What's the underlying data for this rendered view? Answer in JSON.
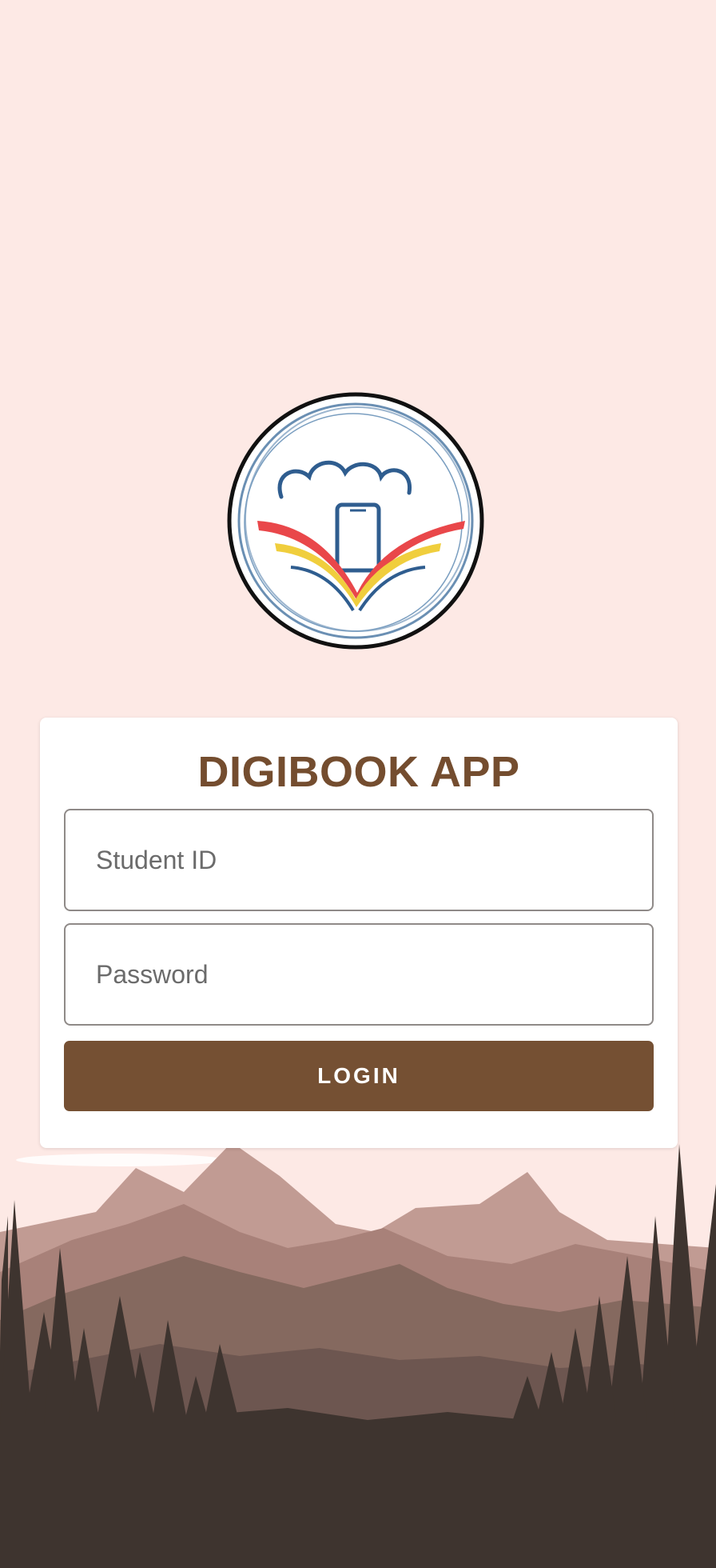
{
  "app": {
    "title": "DIGIBOOK APP"
  },
  "login_form": {
    "student_id_placeholder": "Student ID",
    "student_id_value": "",
    "password_placeholder": "Password",
    "password_value": "",
    "login_label": "LOGIN"
  },
  "icons": {
    "logo": "digibook-logo-icon",
    "background": "mountain-forest-landscape"
  },
  "colors": {
    "background": "#fde9e5",
    "title": "#744d2f",
    "button": "#755033",
    "button_text": "#ffffff",
    "field_border": "#8f8a88",
    "forest_dark": "#3e342f",
    "mountain_mid": "#7d6560",
    "mountain_light": "#b38c85"
  }
}
